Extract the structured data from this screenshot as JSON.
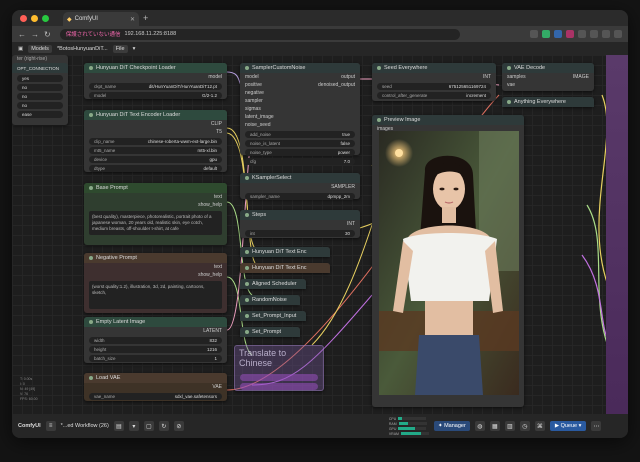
{
  "browser": {
    "tab_title": "ComfyUI",
    "url_warning": "保護されていない通信",
    "url": "192.168.11.225:8188"
  },
  "menu": {
    "models_label": "Models",
    "workflow_tab": "*BotosHunyuanDiT...",
    "file_label": "File"
  },
  "left_panel": {
    "title": "ter (right-rise)",
    "header": "OPT_CONNECTION",
    "rows": [
      "yes",
      "no",
      "no",
      "no",
      "ease"
    ]
  },
  "nodes": {
    "checkpoint": {
      "title": "Hunyuan DiT Checkpoint Loader",
      "out": "model",
      "ckpt_label": "ckpt_name",
      "ckpt_value": "dit/HunYuanDiT/HunYuanDiT12.pt",
      "model_label": "model",
      "model_value": "G/2-1.2"
    },
    "text_encoder": {
      "title": "Hunyuan DiT Text Encoder Loader",
      "out": "CLIP",
      "out2": "T5",
      "clip_label": "clip_name",
      "clip_value": "chinese-roberta-wwm-ext-large.bin",
      "mt5_label": "mt5_name",
      "mt5_value": "mt5-xl.bin",
      "device_label": "device",
      "device_value": "gpu",
      "dtype_label": "dtype",
      "dtype_value": "default"
    },
    "base_prompt": {
      "title": "Base Prompt",
      "out": "text",
      "show_help": "show_help",
      "text": "(best quality), masterpiece, photorealistic, portrait photo of a japanese woman, 20 years old, realistic skin, eye cotch, medium breasts, off-shoulder t-shirt, at cafe"
    },
    "negative_prompt": {
      "title": "Negative Prompt",
      "out": "text",
      "show_help": "show_help",
      "text": "(worst quality:1.2), illustration, 3d, 2d, painting, cartoons, sketch,"
    },
    "empty_latent": {
      "title": "Empty Latent Image",
      "out": "LATENT",
      "width_label": "width",
      "width_value": "832",
      "height_label": "height",
      "height_value": "1216",
      "batch_label": "batch_size",
      "batch_value": "1"
    },
    "load_vae": {
      "title": "Load VAE",
      "out": "VAE",
      "vae_label": "vae_name",
      "vae_value": "sdxl_vae.safetensors"
    },
    "sampler_custom": {
      "title": "SamplerCustomNoise",
      "inputs": [
        "model",
        "positive",
        "negative",
        "sampler",
        "sigmas",
        "latent_image",
        "noise_seed"
      ],
      "out1": "output",
      "out2": "denoised_output",
      "add_noise_label": "add_noise",
      "add_noise_value": "true",
      "noise_is_latent_label": "noise_is_latent",
      "noise_is_latent_value": "false",
      "noise_type_label": "noise_type",
      "noise_type_value": "power",
      "cfg_label": "cfg",
      "cfg_value": "7.0"
    },
    "ksampler_select": {
      "title": "KSamplerSelect",
      "out": "SAMPLER",
      "sampler_label": "sampler_name",
      "sampler_value": "dpmpp_2m"
    },
    "steps": {
      "title": "Steps",
      "out": "INT",
      "label": "int",
      "value": "30"
    },
    "dit_enc1": {
      "title": "Hunyuan DiT Text Enc"
    },
    "dit_enc2": {
      "title": "Hunyuan DiT Text Enc"
    },
    "aligned_scheduler": {
      "title": "Aligned Scheduler"
    },
    "random_noise": {
      "title": "RandomNoise"
    },
    "set_prompt_input": {
      "title": "Set_Prompt_Input"
    },
    "set_prompt": {
      "title": "Set_Prompt"
    },
    "translate": {
      "title": "Translate to Chinese"
    },
    "seed": {
      "title": "Seed Everywhere",
      "out": "INT",
      "seed_label": "seed",
      "seed_value": "675125651169724",
      "control_label": "control_after_generate",
      "control_value": "increment"
    },
    "vae_decode": {
      "title": "VAE Decode",
      "in1": "samples",
      "in2": "vae",
      "out": "IMAGE"
    },
    "anything": {
      "title": "Anything Everywhere"
    },
    "preview": {
      "title": "Preview Image",
      "in": "images"
    }
  },
  "bottom": {
    "app_name": "ComfyUI",
    "workflow": "*...ed Workflow (26)",
    "manager": "Manager",
    "queue": "Queue",
    "stats": [
      {
        "label": "CPU",
        "pct": 12
      },
      {
        "label": "RAM",
        "pct": 35
      },
      {
        "label": "GPU",
        "pct": 60
      },
      {
        "label": "VRAM",
        "pct": 70
      },
      {
        "label": "Temp",
        "pct": 45
      },
      {
        "label": "HDD",
        "pct": 55
      }
    ]
  },
  "colors": {
    "node_bg": "#353535",
    "header_green": "#2e4a3e",
    "header_brown": "#4a3a2e",
    "translate_purple": "#7a5a9a",
    "queue_blue": "#2a5aa0"
  }
}
